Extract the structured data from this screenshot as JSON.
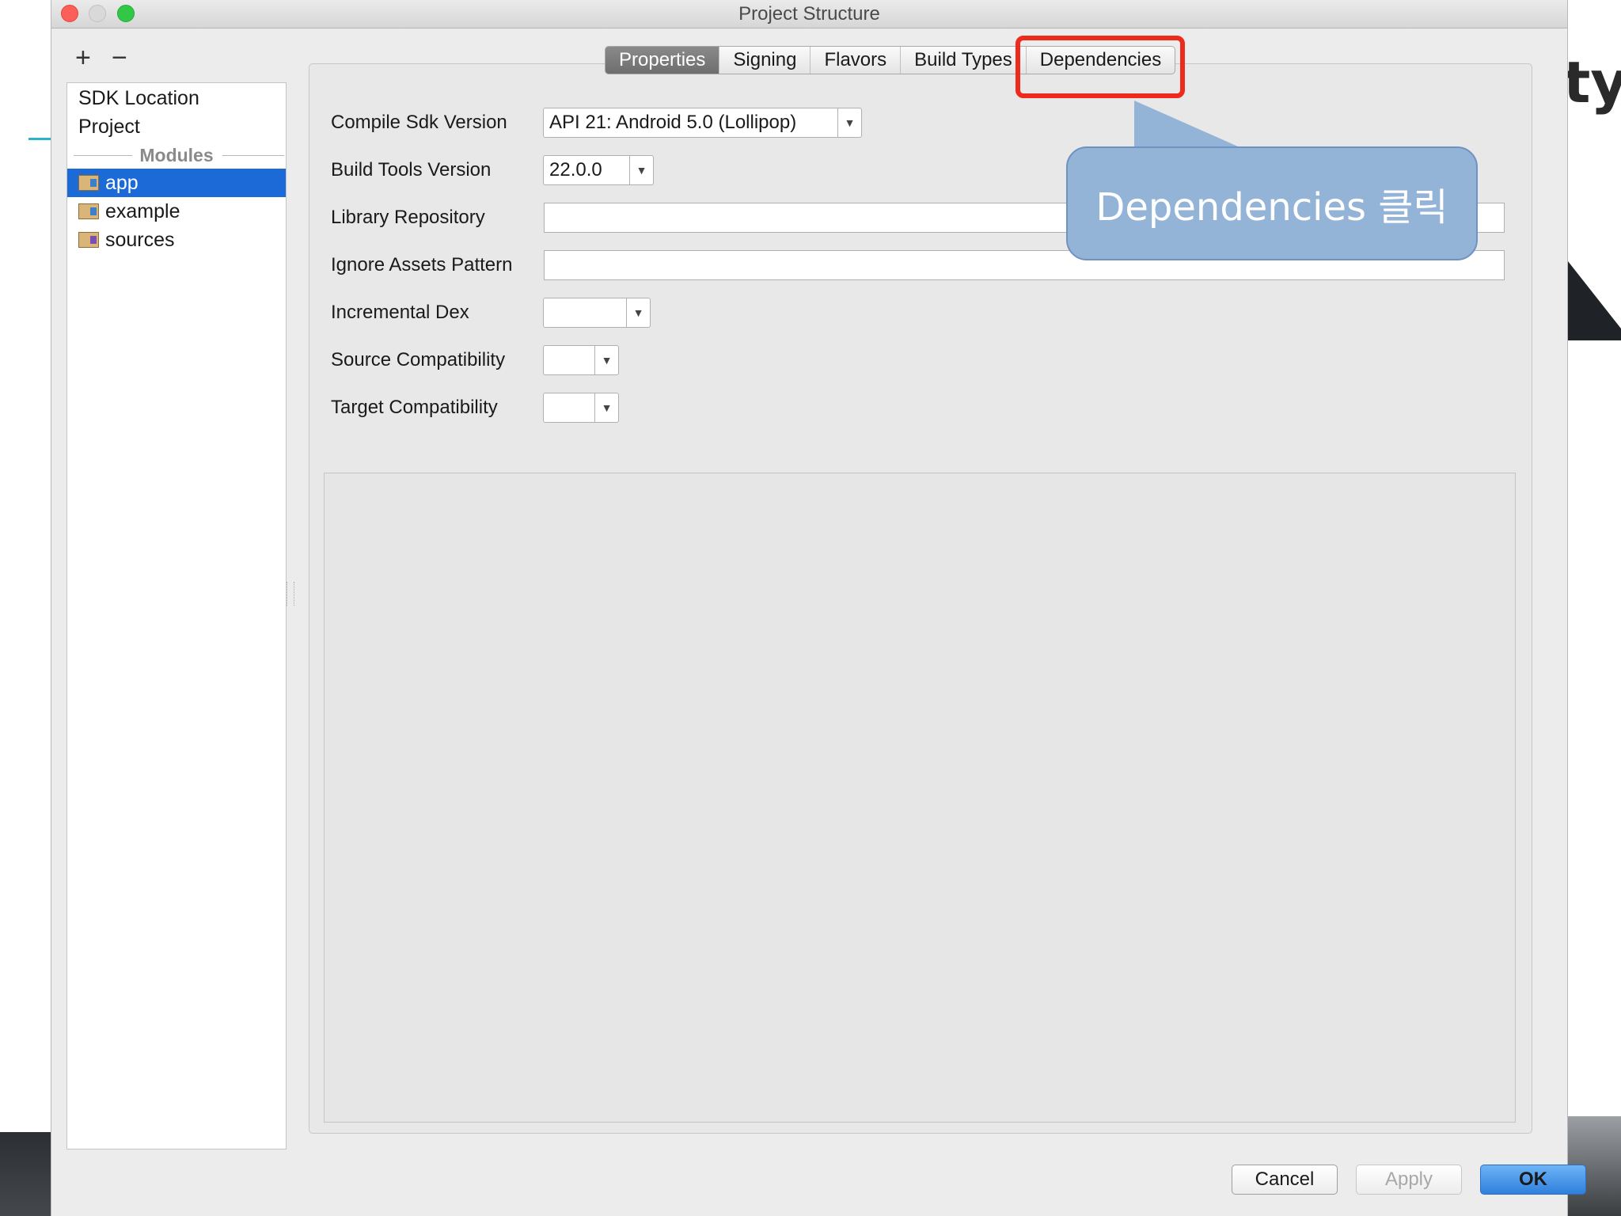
{
  "background": {
    "right_text": "ty"
  },
  "window": {
    "title": "Project Structure"
  },
  "toolbar": {
    "add": "+",
    "remove": "−"
  },
  "sidebar": {
    "items": [
      "SDK Location",
      "Project"
    ],
    "modules_header": "Modules",
    "modules": [
      {
        "label": "app",
        "selected": true,
        "icon": "module-icon"
      },
      {
        "label": "example",
        "selected": false,
        "icon": "module-icon"
      },
      {
        "label": "sources",
        "selected": false,
        "icon": "module-icon"
      }
    ]
  },
  "tabs": [
    {
      "label": "Properties",
      "active": true
    },
    {
      "label": "Signing",
      "active": false
    },
    {
      "label": "Flavors",
      "active": false
    },
    {
      "label": "Build Types",
      "active": false
    },
    {
      "label": "Dependencies",
      "active": false,
      "highlighted": true
    }
  ],
  "form": {
    "compile_sdk": {
      "label": "Compile Sdk Version",
      "value": "API 21: Android 5.0 (Lollipop)"
    },
    "build_tools": {
      "label": "Build Tools Version",
      "value": "22.0.0"
    },
    "library_repo": {
      "label": "Library Repository",
      "value": ""
    },
    "ignore_assets": {
      "label": "Ignore Assets Pattern",
      "value": ""
    },
    "incremental_dex": {
      "label": "Incremental Dex",
      "value": ""
    },
    "source_compat": {
      "label": "Source Compatibility",
      "value": ""
    },
    "target_compat": {
      "label": "Target Compatibility",
      "value": ""
    }
  },
  "callout": {
    "text": "Dependencies 클릭",
    "color": "#93b3d7"
  },
  "buttons": {
    "cancel": "Cancel",
    "apply": "Apply",
    "ok": "OK"
  },
  "colors": {
    "selection": "#1b6ad8",
    "highlight_border": "#ee2a1c",
    "ok_button": "#2f7fdc"
  }
}
